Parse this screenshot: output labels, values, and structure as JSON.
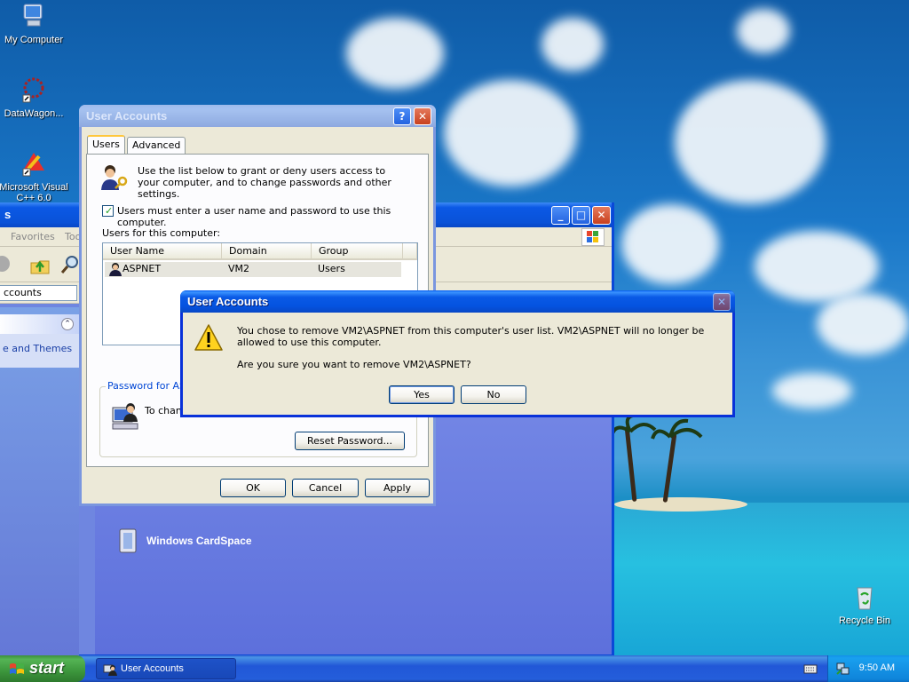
{
  "desktop": {
    "icons": [
      {
        "label": "My Computer"
      },
      {
        "label": "DataWagon..."
      },
      {
        "label": "Microsoft Visual C++ 6.0"
      },
      {
        "label": "Recycle Bin"
      }
    ]
  },
  "explorer": {
    "title": "s",
    "menu": {
      "favorites": "Favorites",
      "tools": "Too"
    },
    "address_value": "ccounts",
    "side_link": "e and Themes",
    "content_item": "Windows CardSpace"
  },
  "user_accounts": {
    "title": "User Accounts",
    "tabs": [
      {
        "label": "Users"
      },
      {
        "label": "Advanced"
      }
    ],
    "intro_text": "Use the list below to grant or deny users access to your computer, and to change passwords and other settings.",
    "checkbox_label": "Users must enter a user name and password to use this computer.",
    "checkbox_checked": true,
    "list_label": "Users for this computer:",
    "columns": [
      "User Name",
      "Domain",
      "Group"
    ],
    "rows": [
      {
        "user": "ASPNET",
        "domain": "VM2",
        "group": "Users"
      }
    ],
    "password_group_label": "Password for ASP",
    "password_text": "To chan",
    "reset_button": "Reset Password...",
    "ok_button": "OK",
    "cancel_button": "Cancel",
    "apply_button": "Apply"
  },
  "confirm_dialog": {
    "title": "User Accounts",
    "message": "You chose to remove VM2\\ASPNET from this computer's user list. VM2\\ASPNET will no longer be allowed to use this computer.",
    "question": "Are you sure you want to remove VM2\\ASPNET?",
    "yes_button": "Yes",
    "no_button": "No"
  },
  "taskbar": {
    "start_label": "start",
    "task_label": "User Accounts",
    "clock": "9:50 AM"
  }
}
